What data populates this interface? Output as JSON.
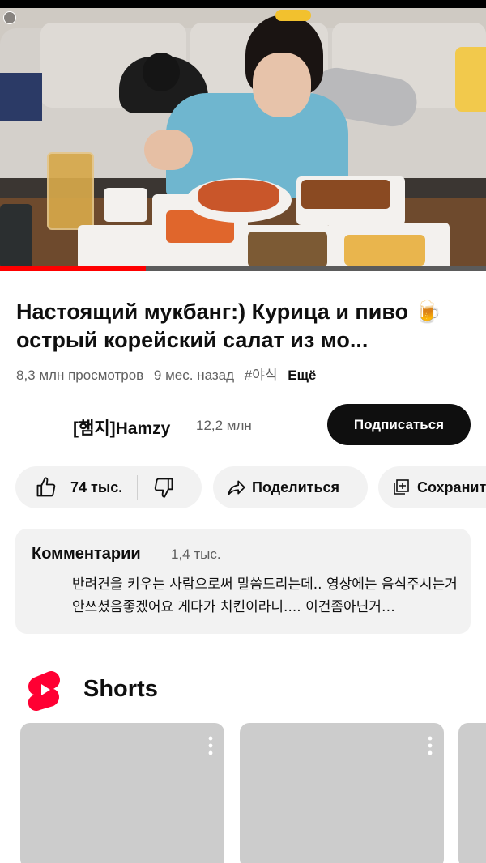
{
  "video": {
    "progress_fraction": 0.3,
    "accent": "#ff0000"
  },
  "title": "Настоящий мукбанг:) Курица и пиво 🍺 острый корейский салат из мо...",
  "meta": {
    "views": "8,3 млн просмотров",
    "age": "9 мес. назад",
    "hashtag": "#야식",
    "more": "Ещё"
  },
  "channel": {
    "name": "[햄지]Hamzy",
    "subscribers": "12,2 млн",
    "subscribe_label": "Подписаться"
  },
  "actions": {
    "likes": "74 тыс.",
    "share": "Поделиться",
    "save": "Сохранить"
  },
  "comments": {
    "header": "Комментарии",
    "count": "1,4 тыс.",
    "preview": "반려견을 키우는 사람으로써 말씀드리는데.. 영상에는 음식주시는거 안쓰셨음좋겠어요 게다가 치킨이라니.... 이건좀아닌거…"
  },
  "shorts": {
    "label": "Shorts",
    "brand_color": "#ff0033"
  },
  "icons": [
    "like-icon",
    "dislike-icon",
    "share-icon",
    "save-icon",
    "shorts-logo-icon",
    "more-vert-icon",
    "video-corner-icon"
  ]
}
